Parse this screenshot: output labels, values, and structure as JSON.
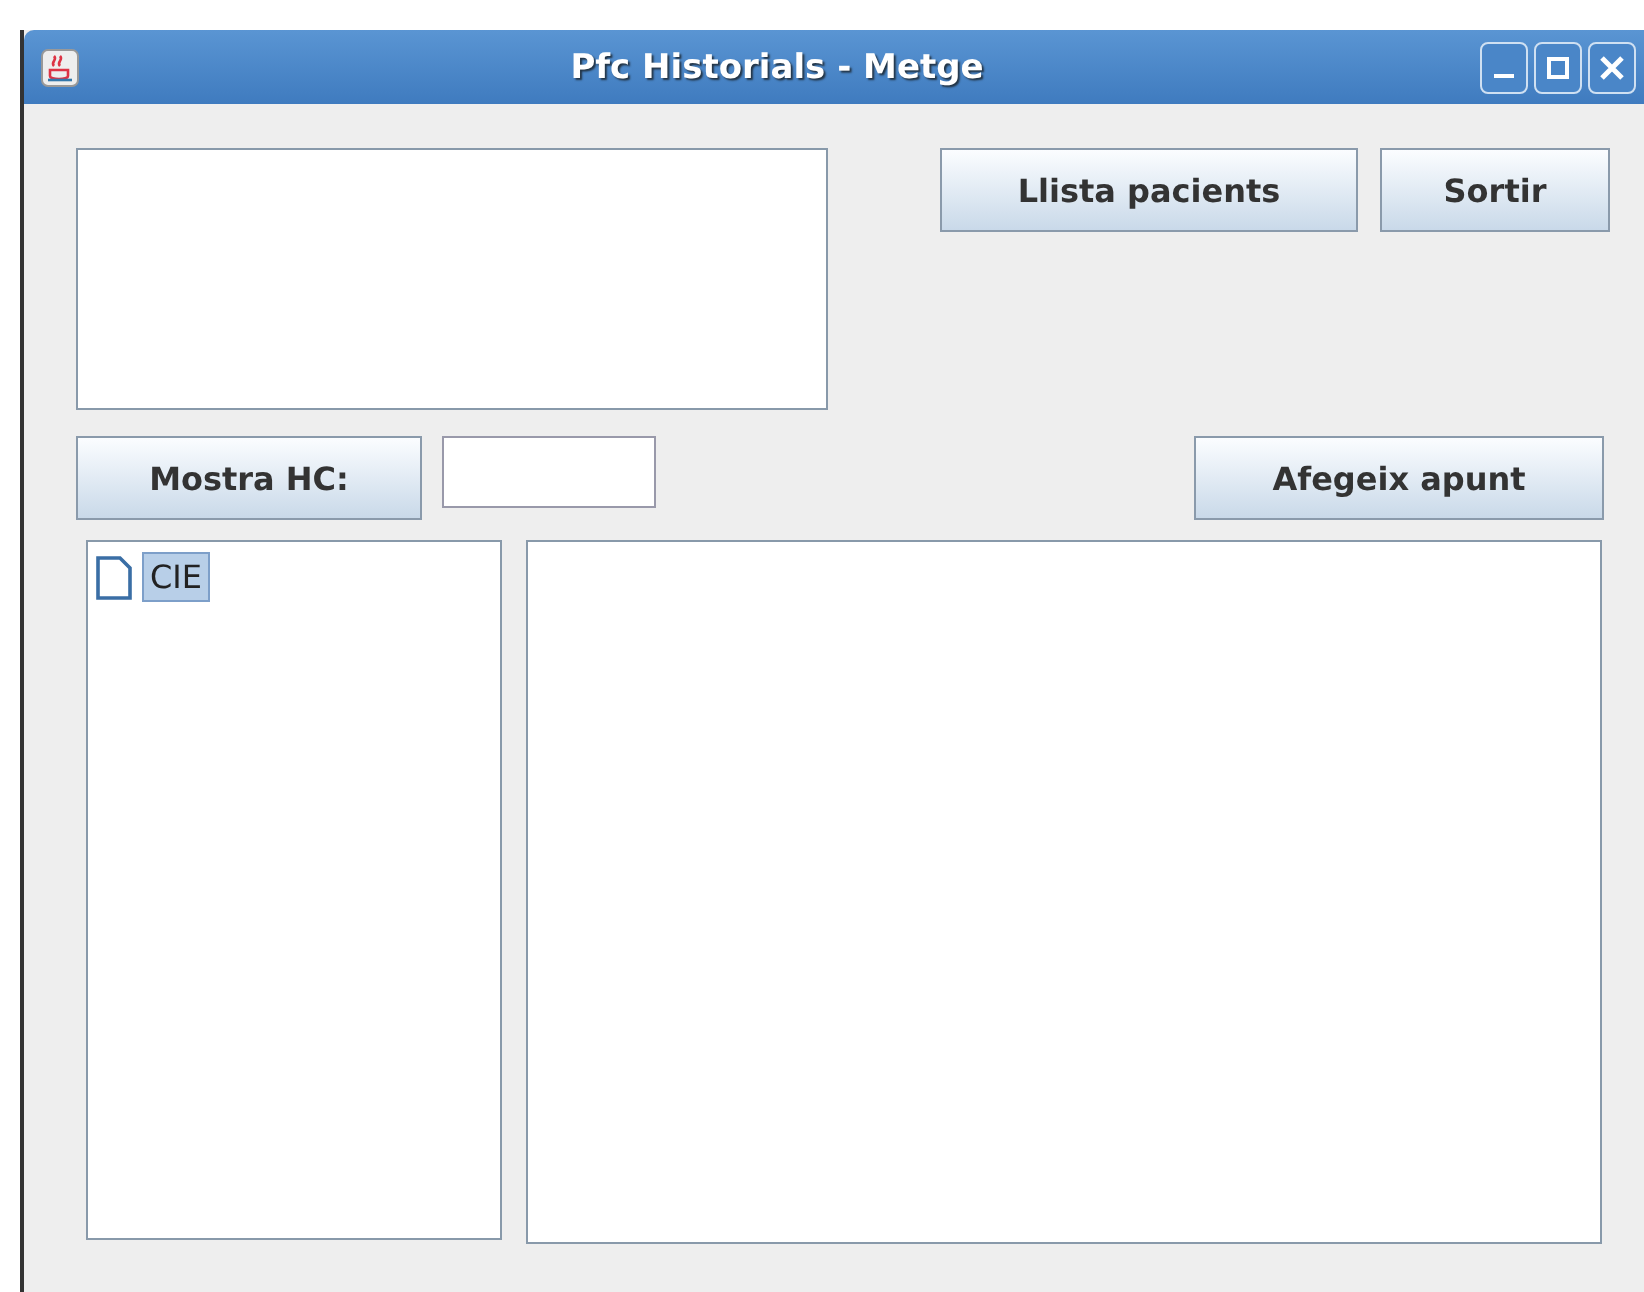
{
  "window": {
    "title": "Pfc Historials - Metge"
  },
  "top_buttons": [
    "Llista pacients",
    "Sortir"
  ],
  "show_button": "Mostra HC:",
  "add_button": "Afegeix apunt",
  "tree": {
    "items": [
      {
        "label": "CIE",
        "selected": true
      }
    ]
  }
}
